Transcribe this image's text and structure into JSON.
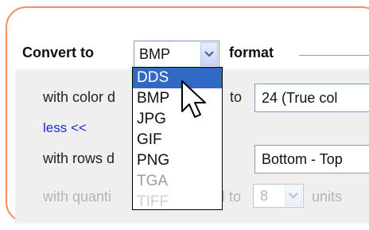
{
  "convert": {
    "prefix": "Convert to",
    "selected_format": "BMP",
    "suffix": "format",
    "options": [
      {
        "label": "DDS",
        "state": "highlighted"
      },
      {
        "label": "BMP",
        "state": "normal"
      },
      {
        "label": "JPG",
        "state": "normal"
      },
      {
        "label": "GIF",
        "state": "normal"
      },
      {
        "label": "PNG",
        "state": "normal"
      },
      {
        "label": "TGA",
        "state": "faded"
      },
      {
        "label": "TIFF",
        "state": "very-faded"
      }
    ]
  },
  "options": {
    "color_depth_label_start": "with color d",
    "color_depth_label_end": "to",
    "color_depth_value": "24 (True col",
    "less_link": "less <<",
    "rows_label": "with rows d",
    "rows_value": "Bottom - Top",
    "quant_label_start": "with quanti",
    "quant_label_mid": "l to",
    "quant_value": "8",
    "quant_unit": "units"
  },
  "colors": {
    "panel_border": "#f08f62",
    "selection": "#3169c6",
    "link": "#1a2fd6"
  },
  "icons": {
    "dropdown_arrow": "chevron-down-icon",
    "cursor": "arrow-cursor-icon"
  }
}
